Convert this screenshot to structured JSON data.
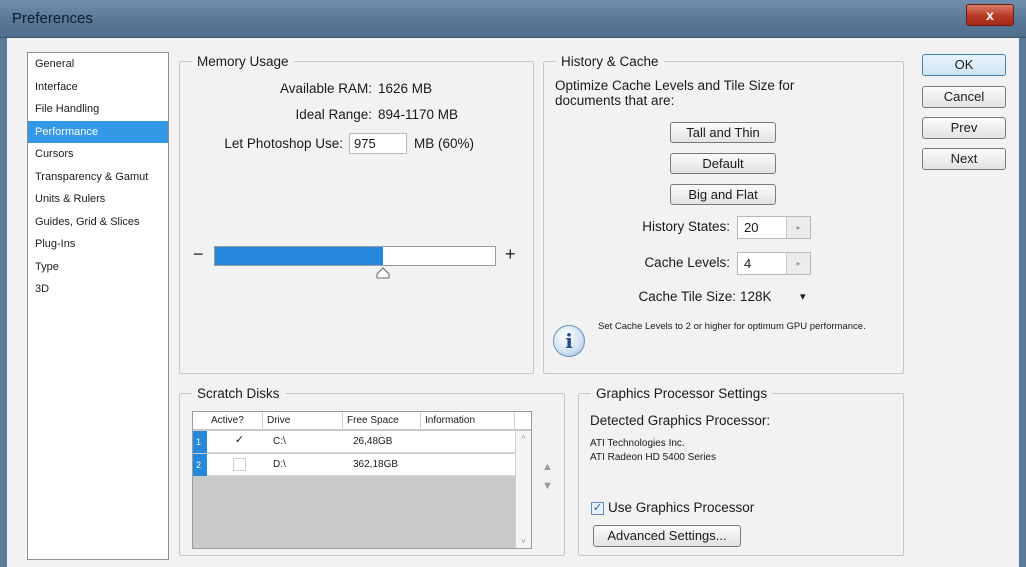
{
  "window": {
    "title": "Preferences",
    "close_label": "x"
  },
  "sidebar": {
    "items": [
      {
        "label": "General",
        "active": false
      },
      {
        "label": "Interface",
        "active": false
      },
      {
        "label": "File Handling",
        "active": false
      },
      {
        "label": "Performance",
        "active": true
      },
      {
        "label": "Cursors",
        "active": false
      },
      {
        "label": "Transparency & Gamut",
        "active": false
      },
      {
        "label": "Units & Rulers",
        "active": false
      },
      {
        "label": "Guides, Grid & Slices",
        "active": false
      },
      {
        "label": "Plug-Ins",
        "active": false
      },
      {
        "label": "Type",
        "active": false
      },
      {
        "label": "3D",
        "active": false
      }
    ]
  },
  "memory": {
    "legend": "Memory Usage",
    "available_label": "Available RAM:",
    "available_value": "1626 MB",
    "ideal_label": "Ideal Range:",
    "ideal_value": "894-1170 MB",
    "use_label": "Let Photoshop Use:",
    "use_value": "975",
    "use_unit": "MB (60%)",
    "minus": "−",
    "plus": "+",
    "slider_fraction": 0.6
  },
  "history": {
    "legend": "History & Cache",
    "description": "Optimize Cache Levels and Tile Size for documents that are:",
    "btn_tall": "Tall and Thin",
    "btn_default": "Default",
    "btn_big": "Big and Flat",
    "states_label": "History States:",
    "states_value": "20",
    "levels_label": "Cache Levels:",
    "levels_value": "4",
    "tile_label": "Cache Tile Size:",
    "tile_value": "128K",
    "dropdown_arrow": "▾",
    "info_text": "Set Cache Levels to 2 or higher for optimum GPU performance.",
    "info_glyph": "i",
    "spin_glyph": "▸"
  },
  "dialog_buttons": {
    "ok": "OK",
    "cancel": "Cancel",
    "prev": "Prev",
    "next": "Next"
  },
  "scratch": {
    "legend": "Scratch Disks",
    "headers": [
      "Active?",
      "Drive",
      "Free Space",
      "Information"
    ],
    "rows": [
      {
        "num": "1",
        "active": true,
        "check": "✓",
        "drive": "C:\\",
        "free": "26,48GB",
        "info": ""
      },
      {
        "num": "2",
        "active": false,
        "check": "",
        "drive": "D:\\",
        "free": "362,18GB",
        "info": ""
      }
    ],
    "scroll_up": "▲",
    "scroll_down": "▼",
    "small_up": "˄",
    "small_down": "˅"
  },
  "gpu": {
    "legend": "Graphics Processor Settings",
    "detected_label": "Detected Graphics Processor:",
    "vendor": "ATI Technologies Inc.",
    "model": "ATI Radeon HD 5400 Series",
    "use_label": "Use Graphics Processor",
    "use_checked": true,
    "check": "✓",
    "advanced_label": "Advanced Settings..."
  },
  "colors": {
    "selection": "#3399e6",
    "slider_fill": "#2588dc",
    "title_bar": "#587896",
    "close_button": "#b83a25"
  }
}
